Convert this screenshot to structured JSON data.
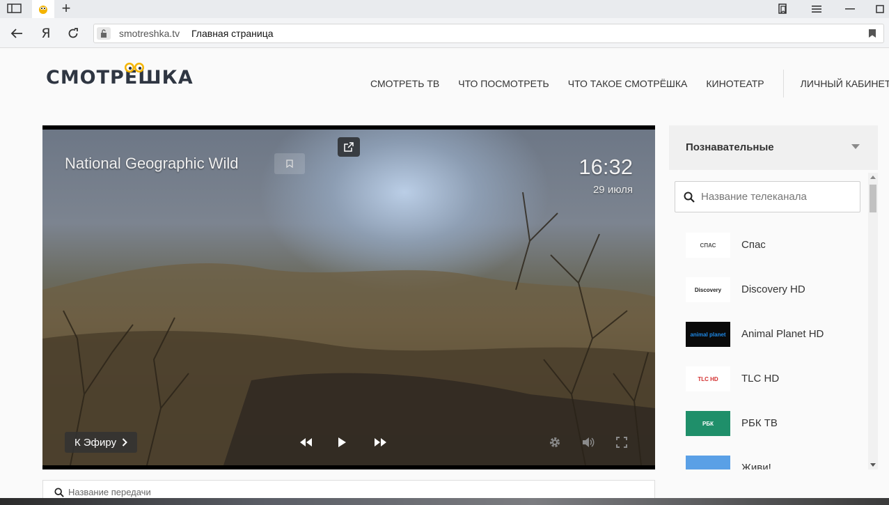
{
  "browser": {
    "domain": "smotreshka.tv",
    "page_title": "Главная страница"
  },
  "site": {
    "logo_text": "СМОТРЁШКА",
    "nav": [
      {
        "label": "СМОТРЕТЬ ТВ"
      },
      {
        "label": "ЧТО ПОСМОТРЕТЬ"
      },
      {
        "label": "ЧТО ТАКОЕ СМОТРЁШКА"
      },
      {
        "label": "КИНОТЕАТР"
      }
    ],
    "account_label": "ЛИЧНЫЙ КАБИНЕТ"
  },
  "player": {
    "channel_title": "National Geographic Wild",
    "time": "16:32",
    "date": "29 июля",
    "live_button_label": "К Эфиру"
  },
  "sidebar": {
    "category": "Познавательные",
    "search_placeholder": "Название телеканала",
    "channels": [
      {
        "name": "Спас",
        "logo_text": "СПАС",
        "logo_bg": "#ffffff",
        "logo_color": "#555555"
      },
      {
        "name": "Discovery HD",
        "logo_text": "Discovery",
        "logo_bg": "#ffffff",
        "logo_color": "#222222"
      },
      {
        "name": "Animal Planet HD",
        "logo_text": "animal planet",
        "logo_bg": "#0a0a0a",
        "logo_color": "#1e88e5"
      },
      {
        "name": "TLC HD",
        "logo_text": "TLC HD",
        "logo_bg": "#ffffff",
        "logo_color": "#d32f2f"
      },
      {
        "name": "РБК ТВ",
        "logo_text": "РБК",
        "logo_bg": "#1f8f6a",
        "logo_color": "#ffffff"
      },
      {
        "name": "Живи!",
        "logo_text": "",
        "logo_bg": "#5aa0e6",
        "logo_color": "#ffffff"
      }
    ]
  },
  "program_search": {
    "placeholder": "Название передачи"
  }
}
